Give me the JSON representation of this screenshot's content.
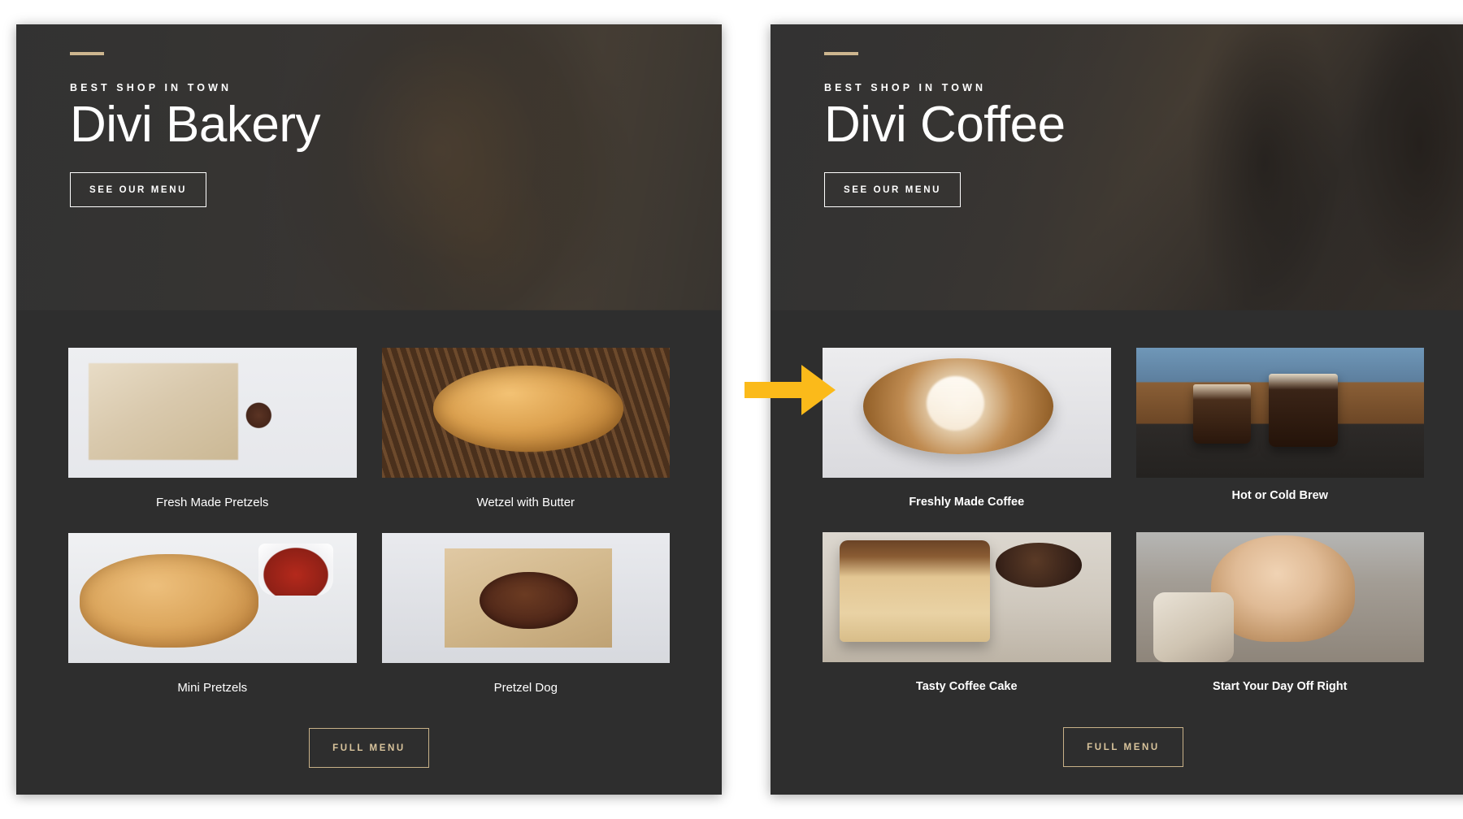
{
  "colors": {
    "panel_background": "#2e2e2e",
    "page_background": "#ffffff",
    "gold_accent": "#cdb68f",
    "gold_button_border": "#c8b188",
    "gold_button_text": "#d9c49c",
    "arrow_yellow": "#fbba1a",
    "text_white": "#ffffff"
  },
  "arrow": {
    "icon": "right-arrow-icon",
    "direction": "right",
    "color": "#fbba1a"
  },
  "panels": [
    {
      "id": "divi-bakery",
      "hero": {
        "accent_bar": "gold-accent-bar",
        "eyebrow": "BEST SHOP IN TOWN",
        "title": "Divi Bakery",
        "cta_label": "SEE OUR MENU",
        "photo": "pretzel-hero-photo"
      },
      "products": [
        {
          "caption": "Fresh Made Pretzels",
          "photo": "pretzel-in-paper-photo"
        },
        {
          "caption": "Wetzel with Butter",
          "photo": "pretzel-on-rack-photo"
        },
        {
          "caption": "Mini Pretzels",
          "photo": "mini-pretzels-photo"
        },
        {
          "caption": "Pretzel Dog",
          "photo": "pretzel-dog-photo"
        }
      ],
      "footer_cta": "FULL MENU"
    },
    {
      "id": "divi-coffee",
      "hero": {
        "accent_bar": "gold-accent-bar",
        "eyebrow": "BEST SHOP IN TOWN",
        "title": "Divi Coffee",
        "cta_label": "SEE OUR MENU",
        "photo": "coffee-glasses-hero-photo"
      },
      "products": [
        {
          "caption": "Freshly Made Coffee",
          "photo": "latte-art-photo"
        },
        {
          "caption": "Hot or Cold Brew",
          "photo": "brew-glasses-photo"
        },
        {
          "caption": "Tasty Coffee Cake",
          "photo": "coffee-cake-photo"
        },
        {
          "caption": "Start Your Day Off Right",
          "photo": "smiling-woman-photo"
        }
      ],
      "footer_cta": "FULL MENU"
    }
  ]
}
